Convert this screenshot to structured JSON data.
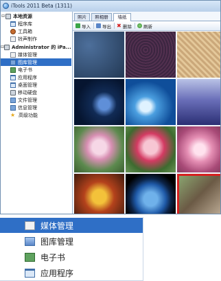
{
  "window": {
    "title": "iTools 2011 Beta (1311)"
  },
  "sidebar": {
    "local": {
      "label": "本地资源",
      "children": [
        {
          "label": "程序库",
          "icon": "window-icon"
        },
        {
          "label": "工具箱",
          "icon": "tool-icon"
        },
        {
          "label": "铃声制作",
          "icon": "media-icon"
        }
      ]
    },
    "device": {
      "label": "Administrator 的 iPa...",
      "children": [
        {
          "label": "媒体管理",
          "icon": "media-icon"
        },
        {
          "label": "图库管理",
          "icon": "folder-icon"
        },
        {
          "label": "电子书",
          "icon": "book-icon"
        },
        {
          "label": "应用程序",
          "icon": "window-icon"
        },
        {
          "label": "桌面管理",
          "icon": "window-icon"
        },
        {
          "label": "移动硬盘",
          "icon": "device-icon"
        },
        {
          "label": "文件管理",
          "icon": "folder-icon"
        },
        {
          "label": "信息管理",
          "icon": "folder-icon"
        },
        {
          "label": "高级功能",
          "icon": "star-icon"
        }
      ]
    }
  },
  "tabs": [
    "照片",
    "照相册",
    "墙纸"
  ],
  "toolbar": {
    "import": "导入",
    "export": "导出",
    "delete": "删除",
    "refresh": "刷新"
  },
  "popup": {
    "items": [
      {
        "label": "媒体管理",
        "icon": "media-icon"
      },
      {
        "label": "图库管理",
        "icon": "gallery-icon"
      },
      {
        "label": "电子书",
        "icon": "book-icon"
      },
      {
        "label": "应用程序",
        "icon": "window-icon"
      }
    ]
  },
  "colors": {
    "selection": "#2f6fc6",
    "sidebar_bg": "#ffffff",
    "selected_thumb_border": "#d62020"
  }
}
